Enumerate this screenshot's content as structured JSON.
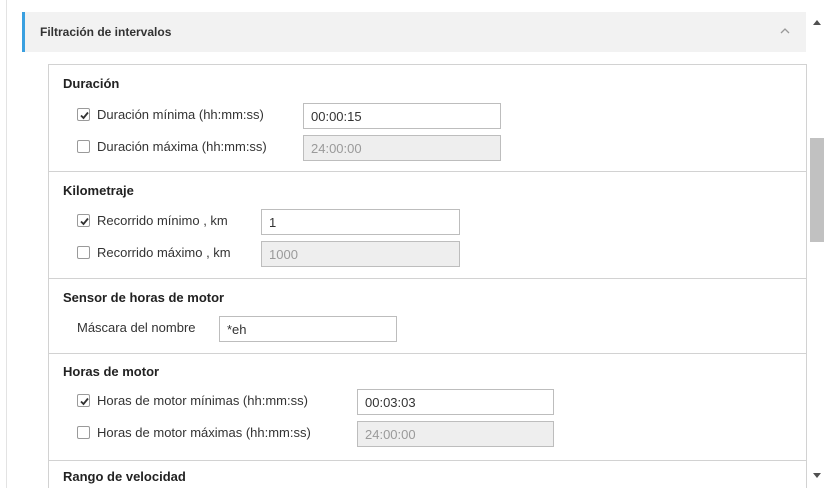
{
  "accordion": {
    "title": "Filtración de intervalos",
    "expanded": true,
    "accent_color": "#3aa0e0"
  },
  "sections": {
    "duration": {
      "title": "Duración",
      "min": {
        "label": "Duración mínima (hh:mm:ss)",
        "checked": true,
        "value": "00:00:15"
      },
      "max": {
        "label": "Duración máxima (hh:mm:ss)",
        "checked": false,
        "value": "24:00:00"
      }
    },
    "mileage": {
      "title": "Kilometraje",
      "min": {
        "label": "Recorrido mínimo , km",
        "checked": true,
        "value": "1"
      },
      "max": {
        "label": "Recorrido máximo , km",
        "checked": false,
        "value": "1000"
      }
    },
    "engine_sensor": {
      "title": "Sensor de horas de motor",
      "mask": {
        "label": "Máscara del nombre",
        "value": "*eh"
      }
    },
    "engine_hours": {
      "title": "Horas de motor",
      "min": {
        "label": "Horas de motor mínimas (hh:mm:ss)",
        "checked": true,
        "value": "00:03:03"
      },
      "max": {
        "label": "Horas de motor máximas (hh:mm:ss)",
        "checked": false,
        "value": "24:00:00"
      }
    },
    "speed_range": {
      "title": "Rango de velocidad"
    }
  }
}
